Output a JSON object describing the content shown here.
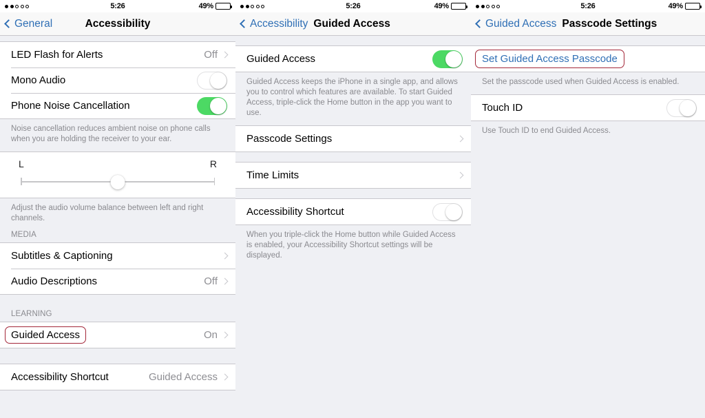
{
  "status_bar": {
    "signal_dots_total": 5,
    "signal_dots_filled": 2,
    "time": "5:26",
    "battery_percent": "49%",
    "battery_level": 49
  },
  "colors": {
    "toggle_on": "#4CD964",
    "link_blue": "#2F6FB5",
    "highlight_red": "#A32638",
    "background_gray": "#EFF0F4",
    "separator": "#C8C7CC",
    "secondary_text": "#8E8E93"
  },
  "screens": [
    {
      "id": "accessibility",
      "nav": {
        "back_label": "General",
        "title": "Accessibility",
        "title_centered": true
      },
      "rows": {
        "led_flash_label": "LED Flash for Alerts",
        "led_flash_value": "Off",
        "mono_audio_label": "Mono Audio",
        "mono_audio_state": "off",
        "phone_noise_label": "Phone Noise Cancellation",
        "phone_noise_state": "on",
        "noise_footnote": "Noise cancellation reduces ambient noise on phone calls when you are holding the receiver to your ear.",
        "balance_left_label": "L",
        "balance_right_label": "R",
        "balance_footnote": "Adjust the audio volume balance between left and right channels.",
        "media_header": "MEDIA",
        "subtitles_label": "Subtitles & Captioning",
        "audio_desc_label": "Audio Descriptions",
        "audio_desc_value": "Off",
        "learning_header": "LEARNING",
        "guided_access_label": "Guided Access",
        "guided_access_value": "On",
        "accessibility_shortcut_label": "Accessibility Shortcut",
        "accessibility_shortcut_value": "Guided Access"
      }
    },
    {
      "id": "guided-access",
      "nav": {
        "back_label": "Accessibility",
        "title": "Guided Access",
        "title_centered": false
      },
      "rows": {
        "guided_access_label": "Guided Access",
        "guided_access_state": "on",
        "guided_access_footnote": "Guided Access keeps the iPhone in a single app, and allows you to control which features are available. To start Guided Access, triple-click the Home button in the app you want to use.",
        "passcode_settings_label": "Passcode Settings",
        "time_limits_label": "Time Limits",
        "accessibility_shortcut_label": "Accessibility Shortcut",
        "accessibility_shortcut_state": "off",
        "accessibility_shortcut_footnote": "When you triple-click the Home button while Guided Access is enabled, your Accessibility Shortcut settings will be displayed."
      }
    },
    {
      "id": "passcode-settings",
      "nav": {
        "back_label": "Guided Access",
        "title": "Passcode Settings",
        "title_centered": false
      },
      "rows": {
        "set_passcode_label": "Set Guided Access Passcode",
        "set_passcode_footnote": "Set the passcode used when Guided Access is enabled.",
        "touch_id_label": "Touch ID",
        "touch_id_state": "off",
        "touch_id_footnote": "Use Touch ID to end Guided Access."
      }
    }
  ]
}
